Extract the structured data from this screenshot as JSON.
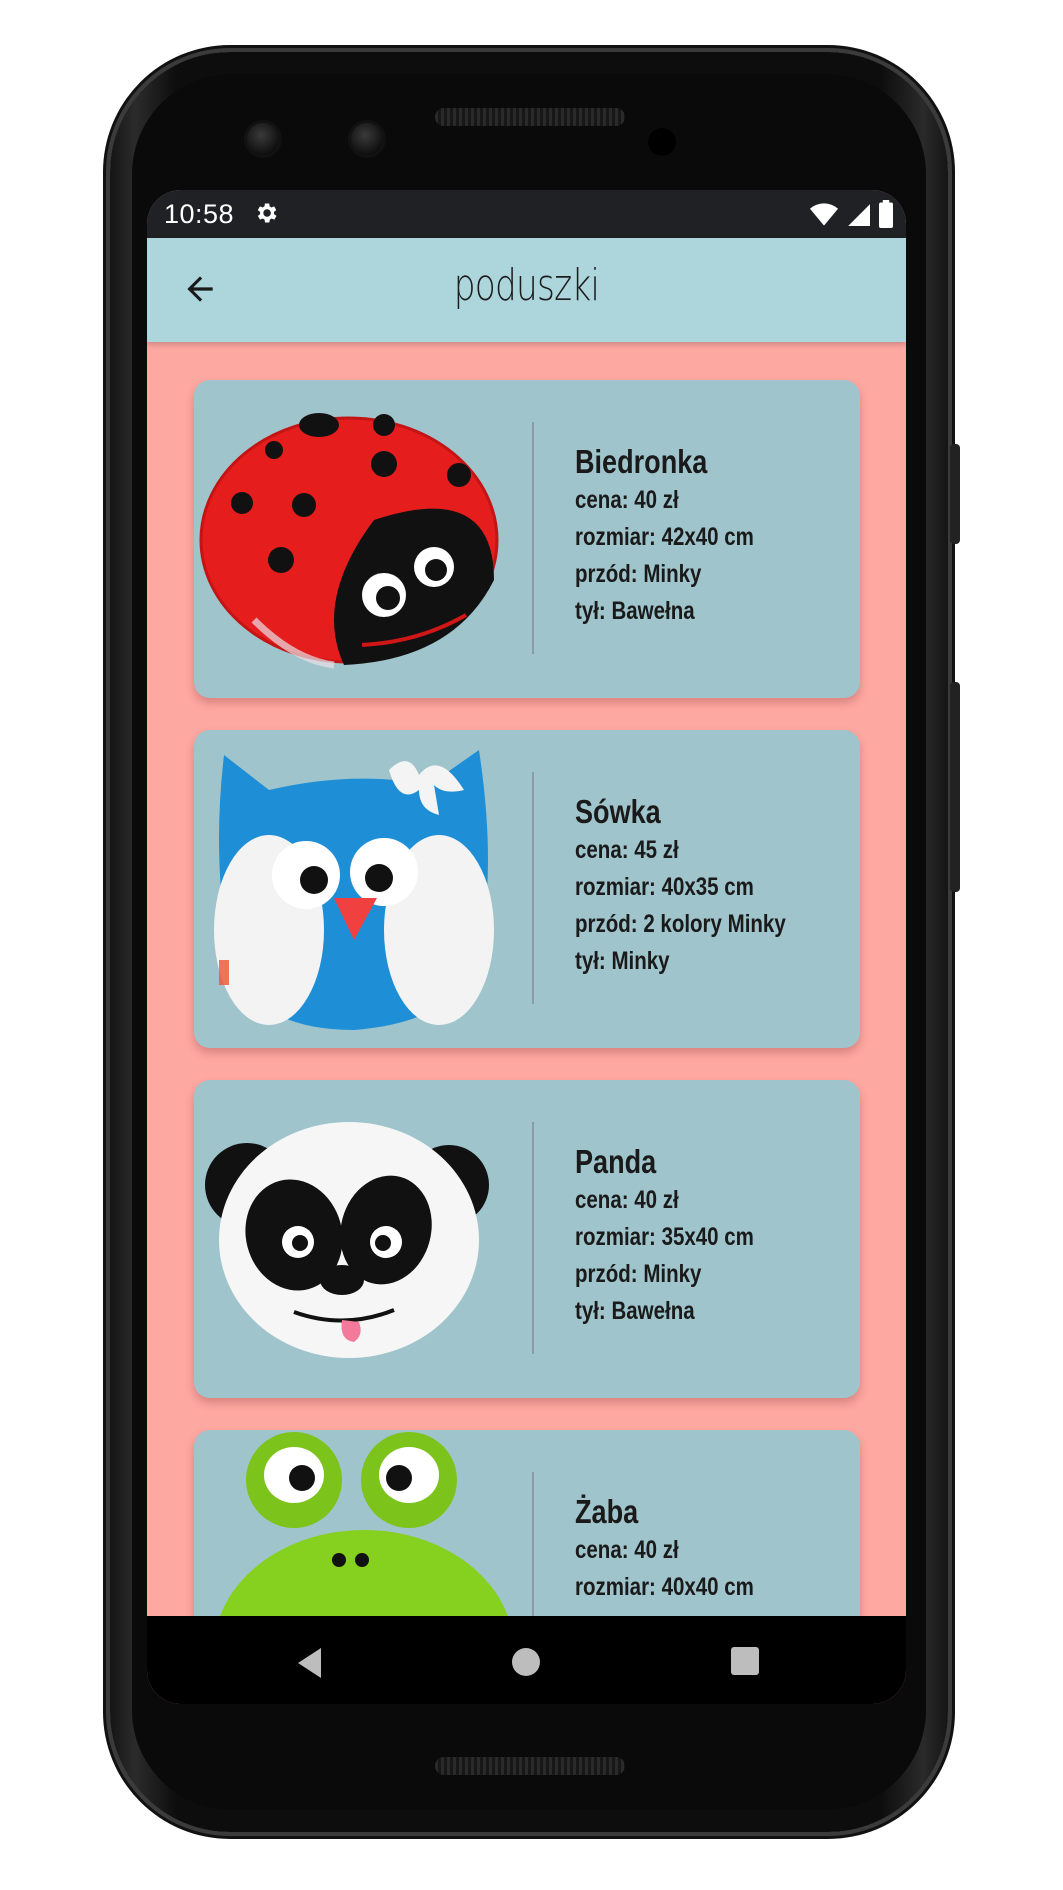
{
  "status_bar": {
    "time": "10:58",
    "icons": [
      "gear-icon",
      "wifi-icon",
      "signal-icon",
      "battery-icon"
    ]
  },
  "app_bar": {
    "title": "poduszki",
    "back_icon": "arrow-left-icon"
  },
  "products": [
    {
      "name": "Biedronka",
      "price": "cena: 40 zł",
      "size": "rozmiar: 42x40 cm",
      "front": "przód: Minky",
      "back": "tył: Bawełna",
      "image": "ladybug-pillow"
    },
    {
      "name": "Sówka",
      "price": "cena: 45 zł",
      "size": "rozmiar: 40x35 cm",
      "front": "przód: 2 kolory Minky",
      "back": "tył: Minky",
      "image": "owl-pillow"
    },
    {
      "name": "Panda",
      "price": "cena: 40 zł",
      "size": "rozmiar: 35x40 cm",
      "front": "przód: Minky",
      "back": "tył: Bawełna",
      "image": "panda-pillow"
    },
    {
      "name": "Żaba",
      "price": "cena: 40 zł",
      "size": "rozmiar: 40x40 cm",
      "image": "frog-pillow"
    }
  ],
  "nav_bar": {
    "icons": [
      "back-triangle-icon",
      "home-circle-icon",
      "recents-square-icon"
    ]
  },
  "colors": {
    "app_bar": "#acd6dc",
    "background": "#fea8a2",
    "card": "#9fc4cb",
    "status_bar": "#202124"
  }
}
